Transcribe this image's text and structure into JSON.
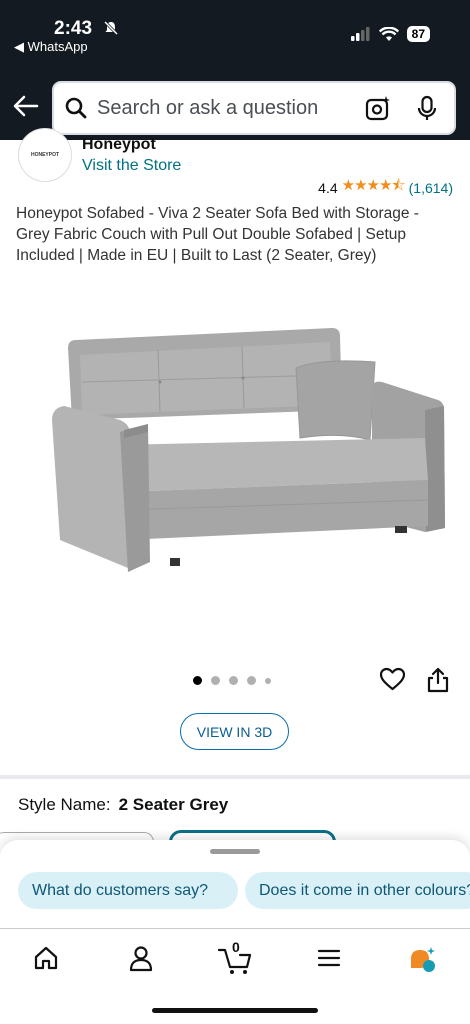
{
  "status_bar": {
    "time": "2:43",
    "back_app": "◀ WhatsApp",
    "battery": "87"
  },
  "search": {
    "placeholder": "Search or ask a question"
  },
  "store": {
    "logo_text": "HONEYPOT",
    "name": "Honeypot",
    "visit_label": "Visit the Store",
    "rating": "4.4",
    "stars": "★★★★⯪",
    "review_count": "(1,614)"
  },
  "product": {
    "title": "Honeypot Sofabed - Viva 2 Seater Sofa Bed with Storage - Grey Fabric Couch with Pull Out Double Sofabed | Setup Included | Made in EU | Built to Last (2 Seater, Grey)",
    "image_count": 5,
    "active_image": 1,
    "view_3d_label": "VIEW IN 3D"
  },
  "style": {
    "label": "Style Name:",
    "value": "2 Seater Grey"
  },
  "suggestions": [
    "What do customers say?",
    "Does it come in other colours?"
  ],
  "nav": {
    "cart_count": "0",
    "items": [
      "home-icon",
      "account-icon",
      "cart-icon",
      "menu-icon",
      "ai-assistant-icon"
    ]
  },
  "colors": {
    "header_bg": "#131a22",
    "link": "#007185",
    "star": "#f28d1e",
    "chip_bg": "#d9f0f7"
  }
}
